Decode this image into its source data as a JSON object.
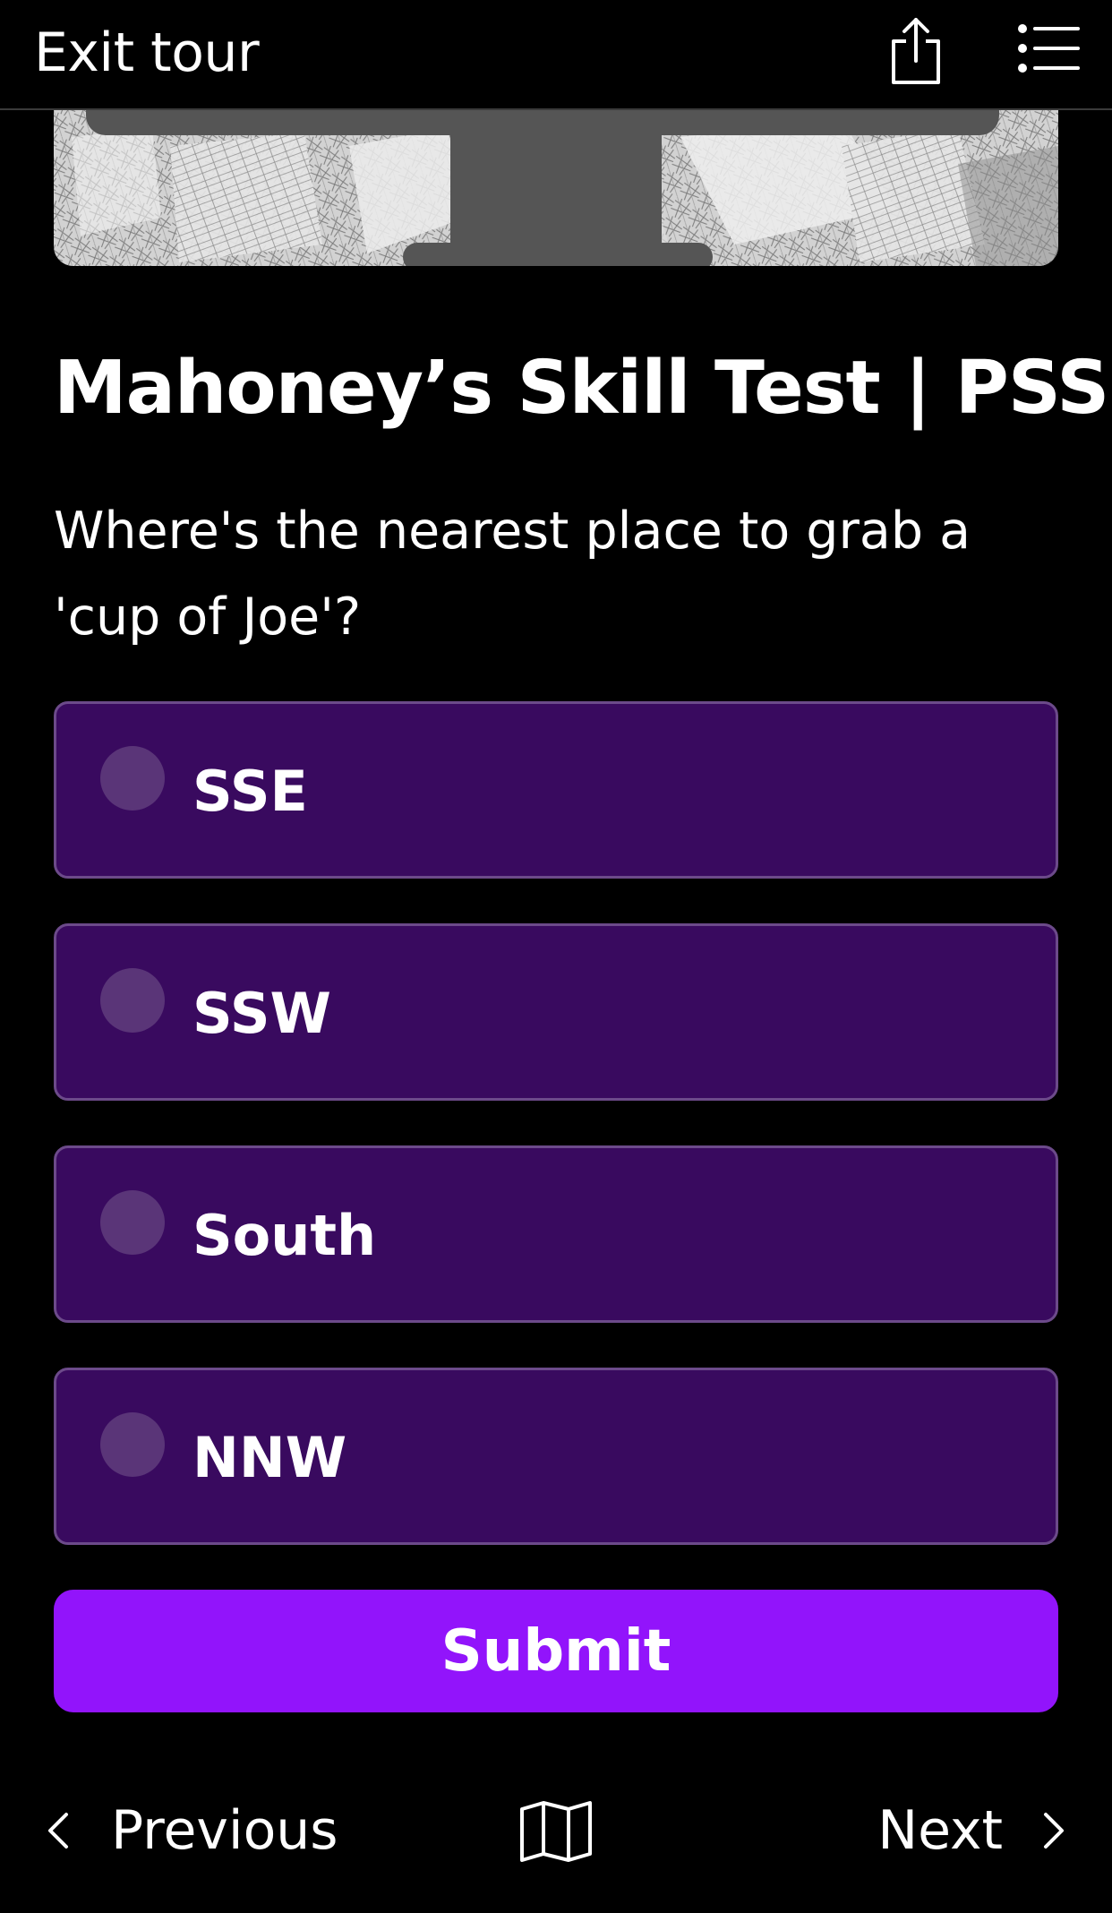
{
  "header": {
    "exit_label": "Exit tour",
    "share_icon": "share-icon",
    "menu_icon": "list-menu-icon"
  },
  "hero": {
    "image": "maps-collage-image"
  },
  "quiz": {
    "title": "Mahoney’s Skill Test | PSS",
    "question": "Where's the nearest place to grab a 'cup of Joe'?",
    "options": [
      {
        "label": "SSE",
        "selected": false
      },
      {
        "label": "SSW",
        "selected": false
      },
      {
        "label": "South",
        "selected": false
      },
      {
        "label": "NNW",
        "selected": false
      }
    ],
    "submit_label": "Submit"
  },
  "footer_nav": {
    "previous_label": "Previous",
    "next_label": "Next",
    "map_icon": "map-icon"
  },
  "colors": {
    "background": "#000000",
    "option_fill": "#390a5f",
    "option_border": "#6c4a8a",
    "radio_fill": "#5a3578",
    "submit_fill": "#9214fb"
  }
}
